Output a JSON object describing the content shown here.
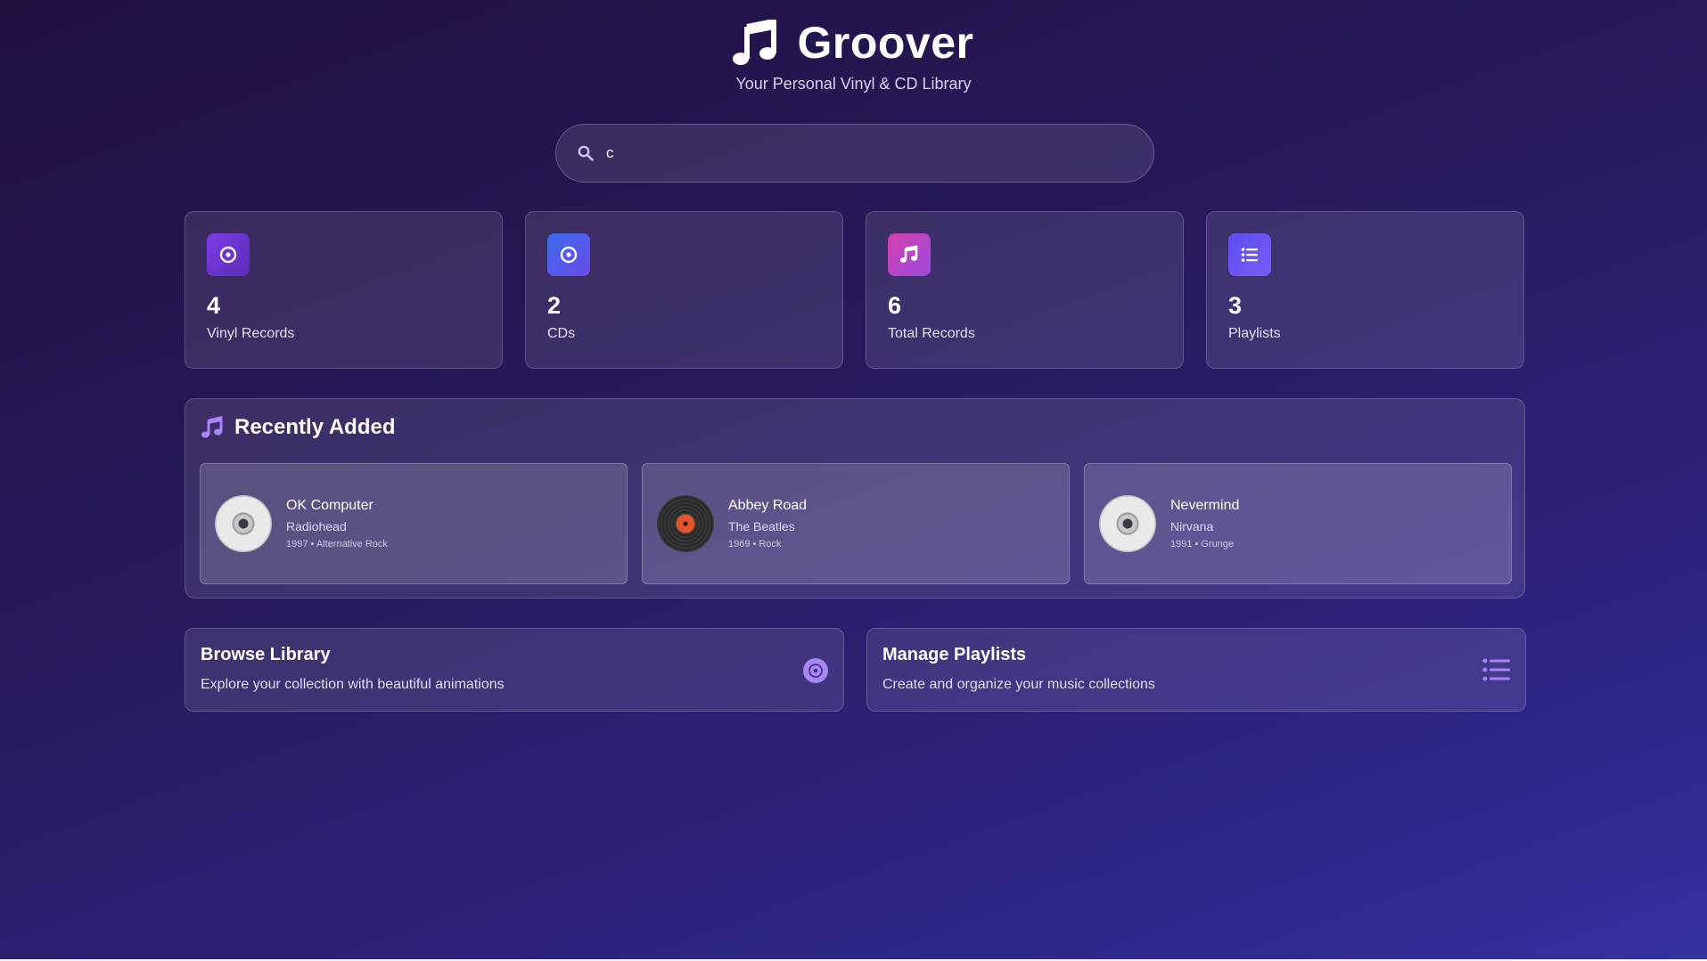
{
  "app": {
    "title": "Groover",
    "subtitle": "Your Personal Vinyl & CD Library",
    "logo_icon": "music-note-icon"
  },
  "search": {
    "value": "c",
    "placeholder": "",
    "icon": "search-icon"
  },
  "stats": [
    {
      "value": "4",
      "label": "Vinyl Records",
      "icon": "vinyl-icon",
      "color_from": "#7b3fe4",
      "color_to": "#5b2bb8"
    },
    {
      "value": "2",
      "label": "CDs",
      "icon": "cd-icon",
      "color_from": "#3b6cf0",
      "color_to": "#6a4be8"
    },
    {
      "value": "6",
      "label": "Total Records",
      "icon": "music-note-icon",
      "color_from": "#d63fa8",
      "color_to": "#9b4be0"
    },
    {
      "value": "3",
      "label": "Playlists",
      "icon": "list-icon",
      "color_from": "#5b4ef0",
      "color_to": "#7a5cf5"
    }
  ],
  "recent": {
    "title": "Recently Added",
    "icon": "music-note-icon",
    "items": [
      {
        "title": "OK Computer",
        "artist": "Radiohead",
        "meta": "1997 • Alternative Rock",
        "format": "cd"
      },
      {
        "title": "Abbey Road",
        "artist": "The Beatles",
        "meta": "1969 • Rock",
        "format": "vinyl"
      },
      {
        "title": "Nevermind",
        "artist": "Nirvana",
        "meta": "1991 • Grunge",
        "format": "cd"
      }
    ]
  },
  "actions": [
    {
      "title": "Browse Library",
      "description": "Explore your collection with beautiful animations",
      "icon": "disc-icon"
    },
    {
      "title": "Manage Playlists",
      "description": "Create and organize your music collections",
      "icon": "list-icon"
    }
  ],
  "colors": {
    "accent": "#9b7cf0",
    "background_start": "#1f1040",
    "background_end": "#3530a0"
  }
}
